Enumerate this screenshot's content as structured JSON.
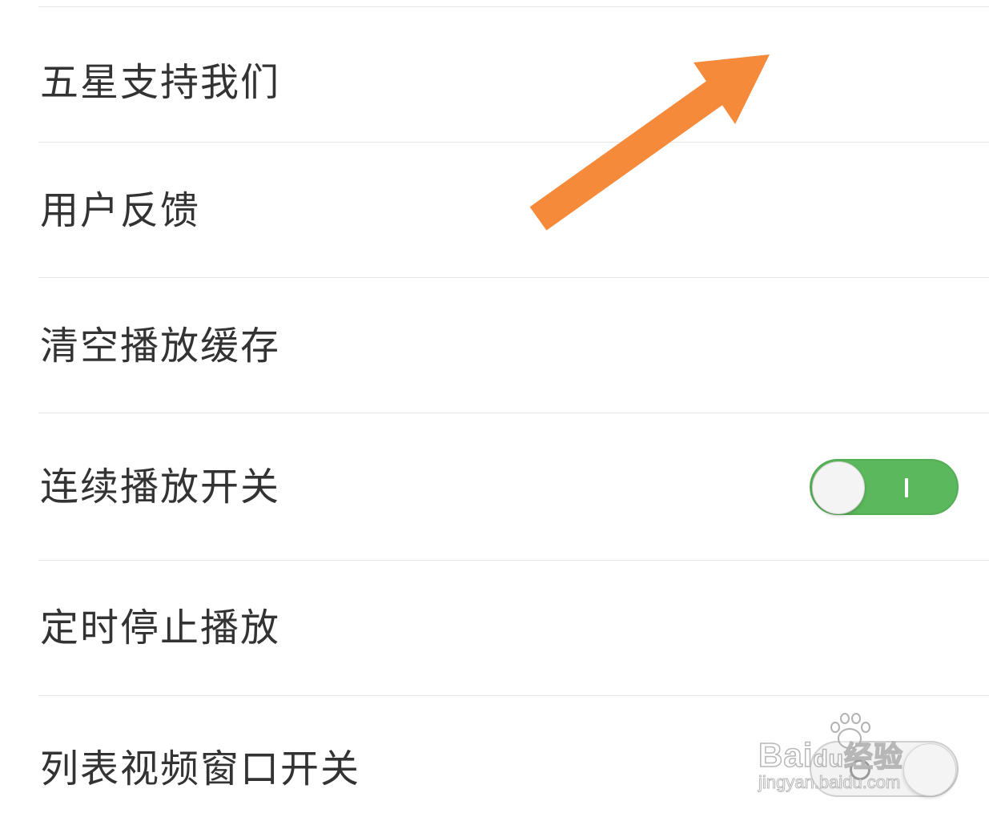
{
  "settings": {
    "items": [
      {
        "label": "五星支持我们",
        "type": "link"
      },
      {
        "label": "用户反馈",
        "type": "link"
      },
      {
        "label": "清空播放缓存",
        "type": "link"
      },
      {
        "label": "连续播放开关",
        "type": "toggle",
        "state": "on"
      },
      {
        "label": "定时停止播放",
        "type": "link"
      },
      {
        "label": "列表视频窗口开关",
        "type": "toggle",
        "state": "off"
      }
    ]
  },
  "overlay": {
    "arrow_icon": "arrow-up-right-icon",
    "arrow_color": "#F58A3A"
  },
  "colors": {
    "toggle_on": "#5CB85C",
    "toggle_off": "#F3F3F3",
    "label_text": "#333333",
    "divider": "#E6E6E6"
  },
  "watermark": {
    "brand": "Bai",
    "brand_suffix": "du",
    "brand_cn": "经验",
    "url": "jingyan.baidu.com"
  }
}
